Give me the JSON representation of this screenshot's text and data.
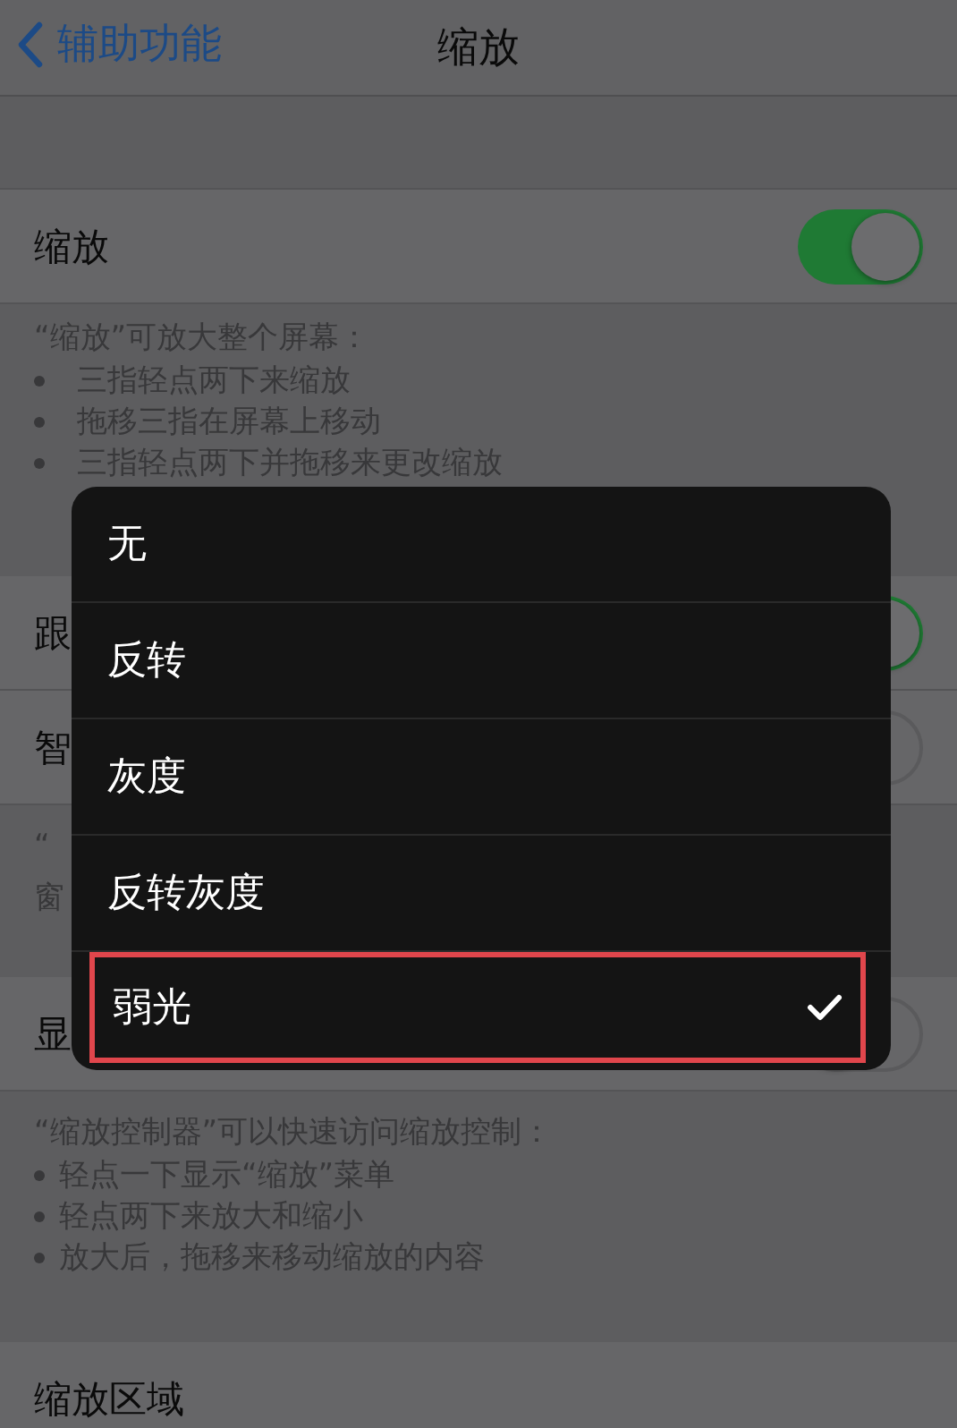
{
  "nav": {
    "back": "辅助功能",
    "title": "缩放"
  },
  "sections": [
    {
      "rows": [
        {
          "label": "缩放",
          "kind": "toggle",
          "on": true
        }
      ],
      "footer": {
        "intro": "“缩放”可放大整个屏幕：",
        "bullets": [
          "三指轻点两下来缩放",
          "拖移三指在屏幕上移动",
          "三指轻点两下并拖移来更改缩放"
        ]
      }
    },
    {
      "rows": [
        {
          "label": "跟",
          "kind": "toggle",
          "on": true
        },
        {
          "label": "智",
          "kind": "toggle",
          "on": false
        }
      ],
      "footer": {
        "lines": [
          "“",
          "窗"
        ]
      }
    },
    {
      "rows": [
        {
          "label": "显",
          "kind": "toggle",
          "on": false
        }
      ],
      "footer": {
        "intro": "“缩放控制器”可以快速访问缩放控制：",
        "bullets": [
          "轻点一下显示“缩放”菜单",
          "轻点两下来放大和缩小",
          "放大后，拖移来移动缩放的内容"
        ]
      }
    },
    {
      "rows": [
        {
          "label": "缩放区域",
          "kind": "plain"
        }
      ]
    }
  ],
  "menu": [
    {
      "label": "无",
      "selected": false
    },
    {
      "label": "反转",
      "selected": false
    },
    {
      "label": "灰度",
      "selected": false
    },
    {
      "label": "反转灰度",
      "selected": false
    },
    {
      "label": "弱光",
      "selected": true
    }
  ]
}
